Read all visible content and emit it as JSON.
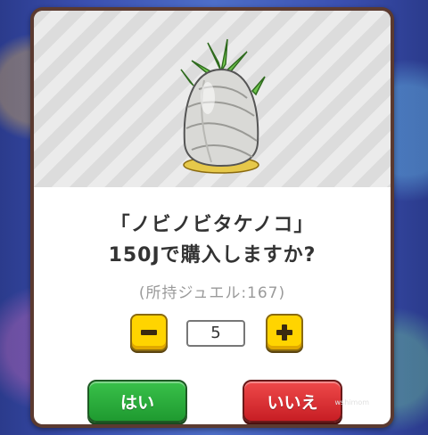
{
  "dialog": {
    "item_name_line": "「ノビノビタケノコ」",
    "question_line": "150Jで購入しますか?",
    "jewels_line": "(所持ジュエル:167)",
    "quantity": "5",
    "yes_label": "はい",
    "no_label": "いいえ",
    "watermark": "wshimom"
  },
  "icons": {
    "item": "bamboo-shoot-icon",
    "minus": "minus-icon",
    "plus": "plus-icon"
  },
  "colors": {
    "yes": "#2aae3c",
    "no": "#dd3034",
    "stepper": "#ffd400",
    "frame": "#5b3a30"
  }
}
